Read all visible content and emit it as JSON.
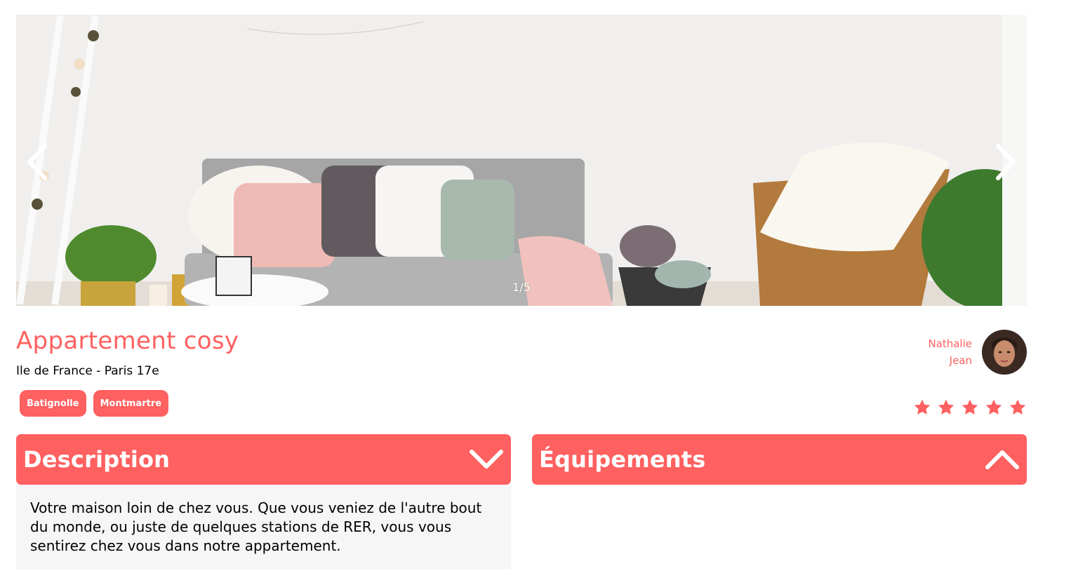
{
  "carousel": {
    "counter": "1/5",
    "prev_icon": "chevron-left-icon",
    "next_icon": "chevron-right-icon"
  },
  "listing": {
    "title": "Appartement cosy",
    "location": "Ile de France - Paris 17e",
    "tags": [
      "Batignolle",
      "Montmartre"
    ]
  },
  "host": {
    "first_name": "Nathalie",
    "last_name": "Jean"
  },
  "rating": {
    "value": 5,
    "max": 5
  },
  "collapses": {
    "description": {
      "title": "Description",
      "state": "open",
      "icon": "chevron-down-icon",
      "text": "Votre maison loin de chez vous. Que vous veniez de l'autre bout du monde, ou juste de quelques stations de RER, vous vous sentirez chez vous dans notre appartement."
    },
    "equipements": {
      "title": "Équipements",
      "state": "closed",
      "icon": "chevron-up-icon"
    }
  },
  "colors": {
    "accent": "#FF6060",
    "panel": "#F6F6F6"
  }
}
